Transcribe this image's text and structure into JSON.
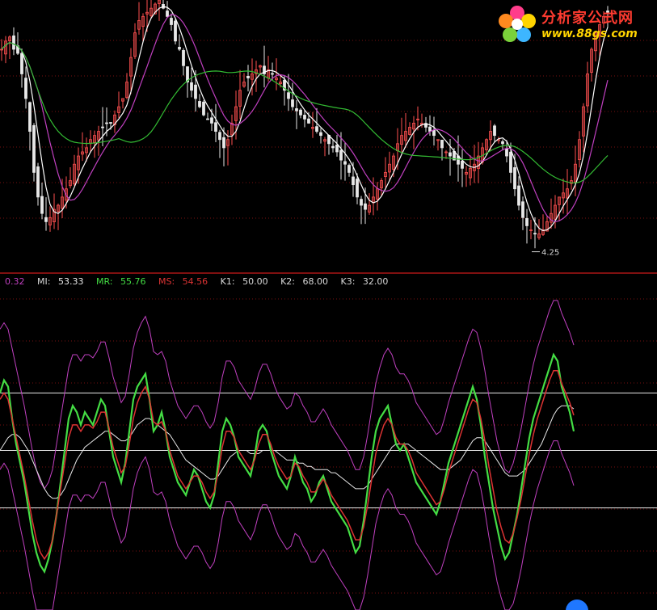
{
  "watermark": {
    "title": "分析家公式网",
    "url": "www.88gs.com"
  },
  "indicator_legend": [
    {
      "label": "",
      "value": "0.32",
      "color": "#c040c0"
    },
    {
      "label": "MI:",
      "value": "53.33",
      "color": "#e8e8e8"
    },
    {
      "label": "MR:",
      "value": "55.76",
      "color": "#44dd44"
    },
    {
      "label": "MS:",
      "value": "54.56",
      "color": "#dd3333"
    },
    {
      "label": "K1:",
      "value": "50.00",
      "color": "#e8e8e8"
    },
    {
      "label": "K2:",
      "value": "68.00",
      "color": "#e8e8e8"
    },
    {
      "label": "K3:",
      "value": "32.00",
      "color": "#e8e8e8"
    }
  ],
  "price_low_label": "4.25",
  "colors": {
    "background": "#000000",
    "up_candle": "#ff5050",
    "down_candle": "#e8e8e8",
    "ma_short": "#ffffff",
    "ma_mid": "#c040c0",
    "ma_long": "#33bb33",
    "mr": "#44dd44",
    "ms": "#dd3333",
    "mi": "#e8e8e8",
    "bands": "#c040c0",
    "grid": "#7a1010",
    "divider": "#ff2020"
  },
  "chart_data": [
    {
      "type": "line",
      "name_hint": "price panel (candlesticks with moving averages)",
      "x": [
        0,
        5,
        10,
        15,
        20,
        25,
        30,
        35,
        40,
        45,
        50,
        55,
        60,
        65,
        70,
        75,
        80,
        85,
        90,
        95,
        100,
        105,
        110,
        115,
        120,
        125,
        130,
        135,
        140,
        145,
        150,
        155,
        160,
        165,
        170,
        175,
        180,
        185,
        190,
        195,
        200,
        205,
        210,
        215,
        220,
        225,
        230,
        235,
        240,
        245,
        250,
        255,
        260,
        265,
        270,
        275,
        280,
        285,
        290,
        295,
        300,
        305,
        310,
        315,
        320,
        325,
        330,
        335,
        340,
        345,
        350,
        355,
        360,
        365,
        370,
        375,
        380,
        385,
        390,
        395,
        400,
        405,
        410,
        415,
        420,
        425,
        430,
        435,
        440,
        445,
        450,
        455,
        460,
        465,
        470,
        475,
        480,
        485,
        490,
        495,
        500,
        505,
        510,
        515,
        520,
        525,
        530,
        535,
        540,
        545,
        550,
        555,
        560,
        565,
        570,
        575,
        580,
        585,
        590,
        595,
        600,
        605,
        610,
        615,
        620,
        625,
        630,
        635,
        640,
        645,
        650,
        655,
        660,
        665,
        670,
        675,
        680,
        685,
        690,
        695,
        700,
        705,
        710,
        715,
        720,
        725,
        730,
        735,
        740,
        745,
        750,
        755,
        760,
        765,
        770,
        775,
        780,
        785,
        790,
        795,
        800,
        805,
        810
      ],
      "close": [
        6.6,
        6.7,
        6.75,
        6.6,
        6.55,
        6.3,
        6.0,
        5.6,
        5.1,
        4.8,
        4.6,
        4.5,
        4.55,
        4.65,
        4.7,
        4.8,
        4.9,
        5.0,
        5.2,
        5.3,
        5.35,
        5.4,
        5.5,
        5.55,
        5.6,
        5.65,
        5.7,
        5.7,
        5.8,
        5.9,
        6.0,
        6.2,
        6.5,
        6.8,
        6.95,
        7.0,
        7.05,
        7.1,
        7.15,
        7.2,
        7.1,
        7.0,
        6.9,
        6.7,
        6.6,
        6.4,
        6.2,
        6.1,
        6.0,
        5.9,
        5.8,
        5.75,
        5.7,
        5.6,
        5.5,
        5.4,
        5.5,
        5.7,
        5.9,
        6.1,
        6.2,
        6.25,
        6.3,
        6.35,
        6.4,
        6.3,
        6.35,
        6.3,
        6.25,
        6.2,
        6.1,
        6.0,
        5.9,
        5.85,
        5.8,
        5.75,
        5.7,
        5.65,
        5.6,
        5.55,
        5.5,
        5.45,
        5.4,
        5.35,
        5.25,
        5.2,
        5.1,
        4.95,
        4.8,
        4.7,
        4.65,
        4.7,
        4.8,
        4.9,
        5.0,
        5.1,
        5.2,
        5.3,
        5.45,
        5.55,
        5.6,
        5.65,
        5.7,
        5.75,
        5.7,
        5.65,
        5.6,
        5.55,
        5.5,
        5.4,
        5.35,
        5.3,
        5.25,
        5.2,
        5.15,
        5.1,
        5.15,
        5.2,
        5.3,
        5.4,
        5.5,
        5.6,
        5.55,
        5.5,
        5.45,
        5.3,
        5.1,
        4.9,
        4.7,
        4.55,
        4.45,
        4.4,
        4.35,
        4.35,
        4.4,
        4.5,
        4.6,
        4.7,
        4.8,
        4.85,
        4.9,
        5.0,
        5.2,
        5.5,
        5.9,
        6.3,
        6.6,
        6.8,
        6.9,
        7.0,
        7.05
      ],
      "ma_short": "5-period smoothing of close",
      "ma_mid": "10-period smoothing of close",
      "ma_long": "30-period smoothing of close",
      "ylim": [
        4.1,
        7.2
      ]
    },
    {
      "type": "line",
      "name_hint": "oscillator panel",
      "reference_lines": {
        "K1": 50.0,
        "K2": 68.0,
        "K3": 32.0
      },
      "x": [
        0,
        5,
        10,
        15,
        20,
        25,
        30,
        35,
        40,
        45,
        50,
        55,
        60,
        65,
        70,
        75,
        80,
        85,
        90,
        95,
        100,
        105,
        110,
        115,
        120,
        125,
        130,
        135,
        140,
        145,
        150,
        155,
        160,
        165,
        170,
        175,
        180,
        185,
        190,
        195,
        200,
        205,
        210,
        215,
        220,
        225,
        230,
        235,
        240,
        245,
        250,
        255,
        260,
        265,
        270,
        275,
        280,
        285,
        290,
        295,
        300,
        305,
        310,
        315,
        320,
        325,
        330,
        335,
        340,
        345,
        350,
        355,
        360,
        365,
        370,
        375,
        380,
        385,
        390,
        395,
        400,
        405,
        410,
        415,
        420,
        425,
        430,
        435,
        440,
        445,
        450,
        455,
        460,
        465,
        470,
        475,
        480,
        485,
        490,
        495,
        500,
        505,
        510,
        515,
        520,
        525,
        530,
        535,
        540,
        545,
        550,
        555,
        560,
        565,
        570,
        575,
        580,
        585,
        590,
        595,
        600,
        605,
        610,
        615,
        620,
        625,
        630,
        635,
        640,
        645,
        650,
        655,
        660,
        665,
        670,
        675,
        680,
        685,
        690,
        695,
        700,
        705,
        710,
        715,
        720,
        725,
        730,
        735,
        740,
        745,
        750,
        755,
        760,
        765,
        770,
        775,
        780,
        785,
        790,
        795,
        800,
        805,
        810
      ],
      "MR": [
        68,
        72,
        70,
        60,
        52,
        46,
        40,
        32,
        24,
        18,
        14,
        12,
        16,
        22,
        30,
        40,
        50,
        60,
        64,
        62,
        58,
        62,
        60,
        58,
        62,
        66,
        64,
        56,
        48,
        44,
        40,
        46,
        56,
        66,
        70,
        72,
        74,
        66,
        56,
        58,
        62,
        56,
        48,
        44,
        40,
        38,
        36,
        40,
        44,
        42,
        38,
        34,
        32,
        36,
        46,
        56,
        60,
        58,
        54,
        48,
        46,
        44,
        42,
        48,
        56,
        58,
        56,
        50,
        46,
        42,
        40,
        38,
        42,
        48,
        44,
        40,
        38,
        34,
        36,
        40,
        42,
        38,
        34,
        32,
        30,
        28,
        26,
        22,
        18,
        20,
        28,
        38,
        48,
        56,
        60,
        62,
        64,
        58,
        52,
        50,
        52,
        48,
        44,
        40,
        38,
        36,
        34,
        32,
        30,
        34,
        40,
        46,
        50,
        54,
        58,
        62,
        66,
        70,
        66,
        58,
        48,
        40,
        32,
        26,
        20,
        16,
        18,
        24,
        30,
        38,
        46,
        54,
        60,
        64,
        68,
        72,
        76,
        80,
        78,
        70,
        66,
        62,
        56
      ],
      "MS": [
        66,
        68,
        66,
        60,
        54,
        48,
        42,
        35,
        28,
        22,
        18,
        16,
        18,
        22,
        30,
        38,
        46,
        54,
        58,
        58,
        56,
        58,
        58,
        57,
        59,
        62,
        62,
        57,
        51,
        47,
        43,
        45,
        52,
        60,
        65,
        68,
        70,
        66,
        59,
        58,
        59,
        56,
        50,
        46,
        42,
        40,
        38,
        40,
        42,
        42,
        40,
        37,
        35,
        37,
        43,
        51,
        56,
        56,
        54,
        50,
        48,
        46,
        44,
        47,
        52,
        55,
        55,
        52,
        48,
        45,
        43,
        41,
        42,
        46,
        45,
        42,
        40,
        37,
        37,
        39,
        41,
        39,
        36,
        34,
        32,
        30,
        28,
        25,
        22,
        22,
        26,
        33,
        41,
        49,
        54,
        58,
        60,
        58,
        54,
        52,
        52,
        50,
        47,
        43,
        41,
        39,
        37,
        35,
        33,
        34,
        38,
        43,
        47,
        51,
        55,
        59,
        63,
        66,
        65,
        60,
        53,
        45,
        38,
        31,
        26,
        22,
        21,
        24,
        29,
        35,
        42,
        49,
        55,
        60,
        64,
        68,
        72,
        75,
        75,
        71,
        68,
        65,
        61
      ],
      "MI": [
        50,
        52,
        54,
        55,
        55,
        54,
        52,
        50,
        47,
        44,
        41,
        38,
        36,
        35,
        35,
        36,
        38,
        41,
        44,
        47,
        49,
        51,
        52,
        53,
        54,
        55,
        56,
        56,
        55,
        54,
        53,
        53,
        54,
        56,
        58,
        59,
        60,
        60,
        59,
        58,
        57,
        56,
        55,
        53,
        51,
        49,
        47,
        46,
        45,
        44,
        43,
        42,
        41,
        41,
        42,
        44,
        46,
        48,
        49,
        50,
        50,
        50,
        49,
        49,
        49,
        50,
        50,
        50,
        50,
        49,
        48,
        47,
        47,
        47,
        46,
        46,
        45,
        45,
        44,
        44,
        44,
        44,
        43,
        43,
        42,
        41,
        40,
        39,
        38,
        38,
        38,
        39,
        41,
        43,
        45,
        47,
        49,
        51,
        52,
        52,
        52,
        52,
        51,
        50,
        49,
        48,
        47,
        46,
        45,
        44,
        44,
        44,
        45,
        46,
        47,
        49,
        51,
        53,
        54,
        54,
        53,
        51,
        49,
        47,
        45,
        43,
        42,
        42,
        42,
        43,
        44,
        46,
        48,
        50,
        52,
        55,
        58,
        61,
        63,
        64,
        64,
        64,
        63
      ],
      "ylim": [
        0,
        100
      ]
    }
  ]
}
